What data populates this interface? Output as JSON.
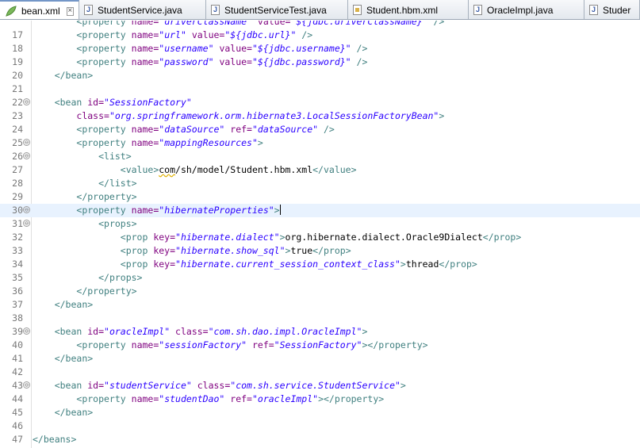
{
  "tabs": [
    {
      "label": "bean.xml",
      "icon": "xml-file-icon",
      "active": true,
      "closable": true
    },
    {
      "label": "StudentService.java",
      "icon": "java-file-icon"
    },
    {
      "label": "StudentServiceTest.java",
      "icon": "java-file-icon"
    },
    {
      "label": "Student.hbm.xml",
      "icon": "xml-file-icon"
    },
    {
      "label": "OracleImpl.java",
      "icon": "java-file-icon"
    },
    {
      "label": "Studer",
      "icon": "java-file-icon"
    }
  ],
  "current_line": 30,
  "lines": [
    {
      "n": "",
      "fold": "",
      "tokens": [
        {
          "c": "tx",
          "t": "        "
        },
        {
          "c": "tg",
          "t": "<property "
        },
        {
          "c": "at",
          "t": "name="
        },
        {
          "c": "vl",
          "t": "\"driverClassName\" "
        },
        {
          "c": "at",
          "t": "value="
        },
        {
          "c": "vl",
          "t": "\"${jdbc.driverClassName}\" "
        },
        {
          "c": "tg",
          "t": "/>"
        }
      ]
    },
    {
      "n": "17",
      "fold": "",
      "tokens": [
        {
          "c": "tx",
          "t": "        "
        },
        {
          "c": "tg",
          "t": "<property "
        },
        {
          "c": "at",
          "t": "name="
        },
        {
          "c": "vl",
          "t": "\"url\" "
        },
        {
          "c": "at",
          "t": "value="
        },
        {
          "c": "vl",
          "t": "\"${jdbc.url}\" "
        },
        {
          "c": "tg",
          "t": "/>"
        }
      ]
    },
    {
      "n": "18",
      "fold": "",
      "tokens": [
        {
          "c": "tx",
          "t": "        "
        },
        {
          "c": "tg",
          "t": "<property "
        },
        {
          "c": "at",
          "t": "name="
        },
        {
          "c": "vl",
          "t": "\"username\" "
        },
        {
          "c": "at",
          "t": "value="
        },
        {
          "c": "vl",
          "t": "\"${jdbc.username}\" "
        },
        {
          "c": "tg",
          "t": "/>"
        }
      ]
    },
    {
      "n": "19",
      "fold": "",
      "tokens": [
        {
          "c": "tx",
          "t": "        "
        },
        {
          "c": "tg",
          "t": "<property "
        },
        {
          "c": "at",
          "t": "name="
        },
        {
          "c": "vl",
          "t": "\"password\" "
        },
        {
          "c": "at",
          "t": "value="
        },
        {
          "c": "vl",
          "t": "\"${jdbc.password}\" "
        },
        {
          "c": "tg",
          "t": "/>"
        }
      ]
    },
    {
      "n": "20",
      "fold": "",
      "tokens": [
        {
          "c": "tx",
          "t": "    "
        },
        {
          "c": "tg",
          "t": "</bean>"
        }
      ]
    },
    {
      "n": "21",
      "fold": "",
      "tokens": []
    },
    {
      "n": "22",
      "fold": "⊖",
      "tokens": [
        {
          "c": "tx",
          "t": "    "
        },
        {
          "c": "tg",
          "t": "<bean "
        },
        {
          "c": "at",
          "t": "id="
        },
        {
          "c": "vl",
          "t": "\"SessionFactory\""
        }
      ]
    },
    {
      "n": "23",
      "fold": "",
      "tokens": [
        {
          "c": "tx",
          "t": "        "
        },
        {
          "c": "at",
          "t": "class="
        },
        {
          "c": "vl",
          "t": "\"org.springframework.orm.hibernate3.LocalSessionFactoryBean\""
        },
        {
          "c": "tg",
          "t": ">"
        }
      ]
    },
    {
      "n": "24",
      "fold": "",
      "tokens": [
        {
          "c": "tx",
          "t": "        "
        },
        {
          "c": "tg",
          "t": "<property "
        },
        {
          "c": "at",
          "t": "name="
        },
        {
          "c": "vl",
          "t": "\"dataSource\" "
        },
        {
          "c": "at",
          "t": "ref="
        },
        {
          "c": "vl",
          "t": "\"dataSource\" "
        },
        {
          "c": "tg",
          "t": "/>"
        }
      ]
    },
    {
      "n": "25",
      "fold": "⊖",
      "tokens": [
        {
          "c": "tx",
          "t": "        "
        },
        {
          "c": "tg",
          "t": "<property "
        },
        {
          "c": "at",
          "t": "name="
        },
        {
          "c": "vl",
          "t": "\"mappingResources\""
        },
        {
          "c": "tg",
          "t": ">"
        }
      ]
    },
    {
      "n": "26",
      "fold": "⊖",
      "tokens": [
        {
          "c": "tx",
          "t": "            "
        },
        {
          "c": "tg",
          "t": "<list>"
        }
      ]
    },
    {
      "n": "27",
      "fold": "",
      "tokens": [
        {
          "c": "tx",
          "t": "                "
        },
        {
          "c": "tg",
          "t": "<value>"
        },
        {
          "c": "tx sq",
          "t": "com"
        },
        {
          "c": "tx",
          "t": "/sh/model/Student.hbm.xml"
        },
        {
          "c": "tg",
          "t": "</value>"
        }
      ]
    },
    {
      "n": "28",
      "fold": "",
      "tokens": [
        {
          "c": "tx",
          "t": "            "
        },
        {
          "c": "tg",
          "t": "</list>"
        }
      ]
    },
    {
      "n": "29",
      "fold": "",
      "tokens": [
        {
          "c": "tx",
          "t": "        "
        },
        {
          "c": "tg",
          "t": "</property>"
        }
      ]
    },
    {
      "n": "30",
      "fold": "⊖",
      "tokens": [
        {
          "c": "tx",
          "t": "        "
        },
        {
          "c": "tg",
          "t": "<property "
        },
        {
          "c": "at",
          "t": "name="
        },
        {
          "c": "vl",
          "t": "\"hibernateProperties\""
        },
        {
          "c": "tg",
          "t": ">"
        },
        {
          "c": "cur",
          "t": ""
        }
      ]
    },
    {
      "n": "31",
      "fold": "⊖",
      "tokens": [
        {
          "c": "tx",
          "t": "            "
        },
        {
          "c": "tg",
          "t": "<props>"
        }
      ]
    },
    {
      "n": "32",
      "fold": "",
      "tokens": [
        {
          "c": "tx",
          "t": "                "
        },
        {
          "c": "tg",
          "t": "<prop "
        },
        {
          "c": "at",
          "t": "key="
        },
        {
          "c": "vl",
          "t": "\"hibernate.dialect\""
        },
        {
          "c": "tg",
          "t": ">"
        },
        {
          "c": "tx",
          "t": "org.hibernate.dialect.Oracle9Dialect"
        },
        {
          "c": "tg",
          "t": "</prop>"
        }
      ]
    },
    {
      "n": "33",
      "fold": "",
      "tokens": [
        {
          "c": "tx",
          "t": "                "
        },
        {
          "c": "tg",
          "t": "<prop "
        },
        {
          "c": "at",
          "t": "key="
        },
        {
          "c": "vl",
          "t": "\"hibernate.show_sql\""
        },
        {
          "c": "tg",
          "t": ">"
        },
        {
          "c": "tx",
          "t": "true"
        },
        {
          "c": "tg",
          "t": "</prop>"
        }
      ]
    },
    {
      "n": "34",
      "fold": "",
      "tokens": [
        {
          "c": "tx",
          "t": "                "
        },
        {
          "c": "tg",
          "t": "<prop "
        },
        {
          "c": "at",
          "t": "key="
        },
        {
          "c": "vl",
          "t": "\"hibernate.current_session_context_class\""
        },
        {
          "c": "tg",
          "t": ">"
        },
        {
          "c": "tx",
          "t": "thread"
        },
        {
          "c": "tg",
          "t": "</prop>"
        }
      ]
    },
    {
      "n": "35",
      "fold": "",
      "tokens": [
        {
          "c": "tx",
          "t": "            "
        },
        {
          "c": "tg",
          "t": "</props>"
        }
      ]
    },
    {
      "n": "36",
      "fold": "",
      "tokens": [
        {
          "c": "tx",
          "t": "        "
        },
        {
          "c": "tg",
          "t": "</property>"
        }
      ]
    },
    {
      "n": "37",
      "fold": "",
      "tokens": [
        {
          "c": "tx",
          "t": "    "
        },
        {
          "c": "tg",
          "t": "</bean>"
        }
      ]
    },
    {
      "n": "38",
      "fold": "",
      "tokens": []
    },
    {
      "n": "39",
      "fold": "⊖",
      "tokens": [
        {
          "c": "tx",
          "t": "    "
        },
        {
          "c": "tg",
          "t": "<bean "
        },
        {
          "c": "at",
          "t": "id="
        },
        {
          "c": "vl",
          "t": "\"oracleImpl\" "
        },
        {
          "c": "at",
          "t": "class="
        },
        {
          "c": "vl",
          "t": "\"com.sh.dao.impl.OracleImpl\""
        },
        {
          "c": "tg",
          "t": ">"
        }
      ]
    },
    {
      "n": "40",
      "fold": "",
      "tokens": [
        {
          "c": "tx",
          "t": "        "
        },
        {
          "c": "tg",
          "t": "<property "
        },
        {
          "c": "at",
          "t": "name="
        },
        {
          "c": "vl",
          "t": "\"sessionFactory\" "
        },
        {
          "c": "at",
          "t": "ref="
        },
        {
          "c": "vl",
          "t": "\"SessionFactory\""
        },
        {
          "c": "tg",
          "t": "></property>"
        }
      ]
    },
    {
      "n": "41",
      "fold": "",
      "tokens": [
        {
          "c": "tx",
          "t": "    "
        },
        {
          "c": "tg",
          "t": "</bean>"
        }
      ]
    },
    {
      "n": "42",
      "fold": "",
      "tokens": []
    },
    {
      "n": "43",
      "fold": "⊖",
      "tokens": [
        {
          "c": "tx",
          "t": "    "
        },
        {
          "c": "tg",
          "t": "<bean "
        },
        {
          "c": "at",
          "t": "id="
        },
        {
          "c": "vl",
          "t": "\"studentService\" "
        },
        {
          "c": "at",
          "t": "class="
        },
        {
          "c": "vl",
          "t": "\"com.sh.service.StudentService\""
        },
        {
          "c": "tg",
          "t": ">"
        }
      ]
    },
    {
      "n": "44",
      "fold": "",
      "tokens": [
        {
          "c": "tx",
          "t": "        "
        },
        {
          "c": "tg",
          "t": "<property "
        },
        {
          "c": "at",
          "t": "name="
        },
        {
          "c": "vl",
          "t": "\"studentDao\" "
        },
        {
          "c": "at",
          "t": "ref="
        },
        {
          "c": "vl",
          "t": "\"oracleImpl\""
        },
        {
          "c": "tg",
          "t": "></property>"
        }
      ]
    },
    {
      "n": "45",
      "fold": "",
      "tokens": [
        {
          "c": "tx",
          "t": "    "
        },
        {
          "c": "tg",
          "t": "</bean>"
        }
      ]
    },
    {
      "n": "46",
      "fold": "",
      "tokens": []
    },
    {
      "n": "47",
      "fold": "",
      "tokens": [
        {
          "c": "tg",
          "t": "</beans>"
        }
      ]
    }
  ]
}
